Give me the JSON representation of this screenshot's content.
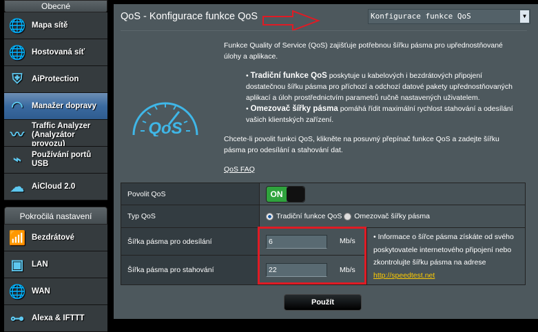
{
  "sidebar": {
    "general_header": "Obecné",
    "items": [
      {
        "label": "Mapa sítě",
        "icon": "globe-pin-icon"
      },
      {
        "label": "Hostovaná síť",
        "icon": "guest-network-icon"
      },
      {
        "label": "AiProtection",
        "icon": "shield-lock-icon"
      },
      {
        "label": "Manažer dopravy",
        "icon": "speedometer-icon"
      },
      {
        "label": "Traffic Analyzer (Analyzátor provozu)",
        "icon": "traffic-analyzer-icon"
      },
      {
        "label": "Používání portů USB",
        "icon": "usb-icon"
      },
      {
        "label": "AiCloud 2.0",
        "icon": "cloud-icon"
      }
    ],
    "advanced_header": "Pokročilá nastavení",
    "advanced_items": [
      {
        "label": "Bezdrátové",
        "icon": "wireless-icon"
      },
      {
        "label": "LAN",
        "icon": "lan-icon"
      },
      {
        "label": "WAN",
        "icon": "wan-globe-icon"
      },
      {
        "label": "Alexa & IFTTT",
        "icon": "alexa-icon"
      }
    ]
  },
  "header": {
    "title": "QoS - Konfigurace funkce QoS",
    "select_value": "Konfigurace funkce QoS"
  },
  "logo_text": "QoS",
  "description": {
    "intro": "Funkce Quality of Service (QoS) zajišťuje potřebnou šířku pásma pro upřednostňované úlohy a aplikace.",
    "bullet1_bold": "Tradiční funkce QoS",
    "bullet1_text": " poskytuje u kabelových i bezdrátových připojení dostatečnou šířku pásma pro příchozí a odchozí datové pakety upřednostňovaných aplikací a úloh prostřednictvím parametrů ručně nastavených uživatelem.",
    "bullet2_bold": "Omezovač šířky pásma",
    "bullet2_text": " pomáhá řídit maximální rychlost stahování a odesílání vašich klientských zařízení.",
    "instructions": "Chcete-li povolit funkci QoS, klikněte na posuvný přepínač funkce QoS a zadejte šířku pásma pro odesílání a stahování dat.",
    "faq_link": "QoS FAQ"
  },
  "form": {
    "enable_label": "Povolit QoS",
    "enable_state": "ON",
    "type_label": "Typ QoS",
    "type_option1": "Tradiční funkce QoS",
    "type_option2": "Omezovač šířky pásma",
    "upload_label": "Šířka pásma pro odesílání",
    "upload_value": "6",
    "upload_unit": "Mb/s",
    "download_label": "Šířka pásma pro stahování",
    "download_value": "22",
    "download_unit": "Mb/s",
    "info_text": "Informace o šířce pásma získáte od svého poskytovatele internetového připojení nebo zkontrolujte šířku pásma na adrese ",
    "info_link": "http://speedtest.net",
    "apply_label": "Použít"
  }
}
